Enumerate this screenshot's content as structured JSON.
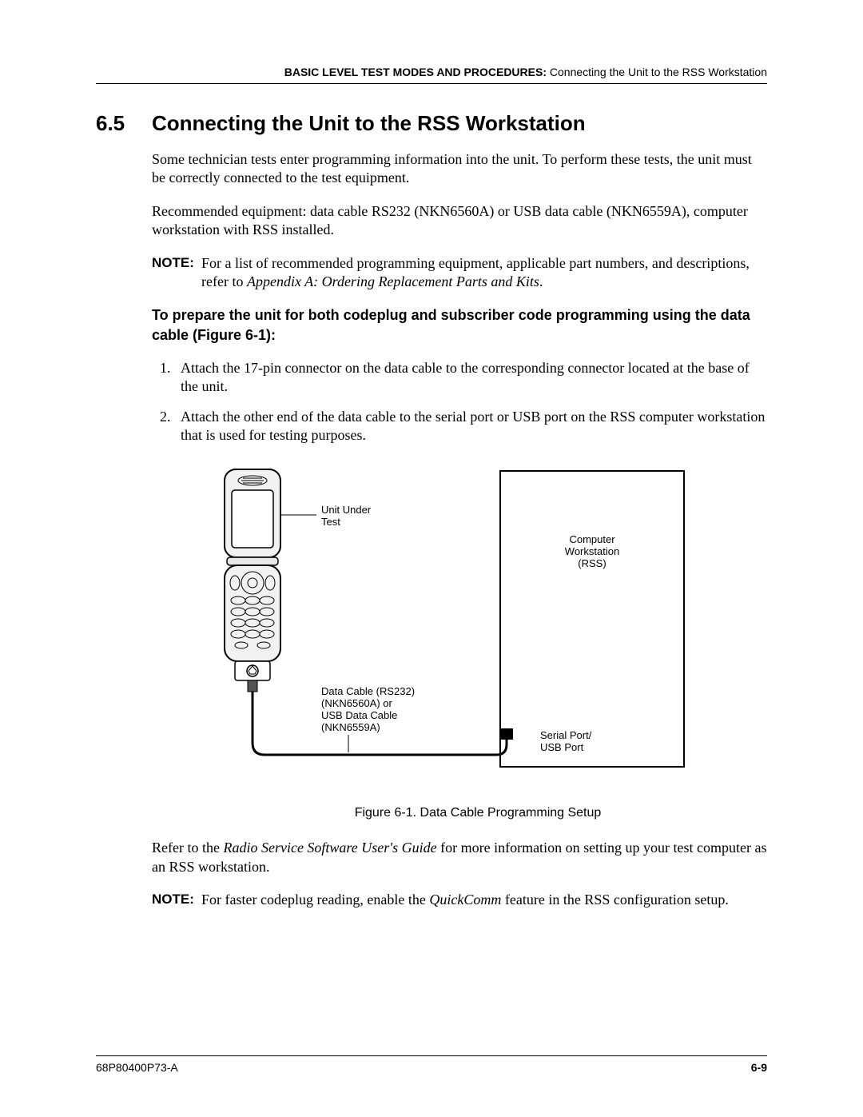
{
  "header": {
    "bold": "BASIC LEVEL TEST MODES AND PROCEDURES:",
    "rest": " Connecting the Unit to the RSS Workstation"
  },
  "section": {
    "number": "6.5",
    "title": "Connecting the Unit to the RSS Workstation"
  },
  "p1": "Some technician tests enter programming information into the unit. To perform these tests, the unit must be correctly connected to the test equipment.",
  "p2": "Recommended equipment: data cable RS232 (NKN6560A) or USB data cable (NKN6559A), computer workstation with RSS installed.",
  "note1": {
    "label": "NOTE:",
    "text_a": "For a list of recommended programming equipment, applicable part numbers, and descriptions, refer to ",
    "text_ital": "Appendix A: Ordering Replacement Parts and Kits",
    "text_b": "."
  },
  "subhead": "To prepare the unit for both codeplug and subscriber code programming using the data cable (Figure 6-1):",
  "steps": [
    "Attach the 17-pin connector on the data cable to the corresponding connector located at the base of the unit.",
    "Attach the other end of the data cable to the serial port or USB port on the RSS computer workstation that is used for testing purposes."
  ],
  "figure": {
    "labels": {
      "unit1": "Unit Under",
      "unit2": "Test",
      "comp1": "Computer",
      "comp2": "Workstation",
      "comp3": "(RSS)",
      "cable1": "Data Cable (RS232)",
      "cable2": "(NKN6560A) or",
      "cable3": "USB Data Cable",
      "cable4": "(NKN6559A)",
      "port1": "Serial Port/",
      "port2": "USB Port"
    },
    "caption": "Figure 6-1. Data Cable Programming Setup"
  },
  "p3a": "Refer to the ",
  "p3ital": "Radio Service Software User's Guide",
  "p3b": " for more information on setting up your test computer as an RSS workstation.",
  "note2": {
    "label": "NOTE:",
    "text_a": "For faster codeplug reading, enable the ",
    "text_ital": "QuickComm",
    "text_b": " feature in the RSS configuration setup."
  },
  "footer": {
    "doc": "68P80400P73-A",
    "page": "6-9"
  }
}
